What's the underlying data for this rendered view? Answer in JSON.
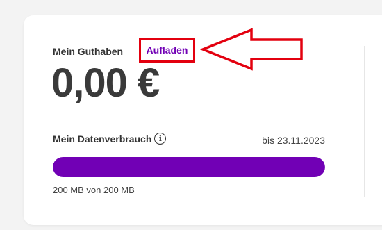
{
  "balance": {
    "label": "Mein Guthaben",
    "topup_label": "Aufladen",
    "value": "0,00 €"
  },
  "data_usage": {
    "label": "Mein Datenverbrauch",
    "info_icon": "info-icon",
    "period": "bis 23.11.2023",
    "progress": 1.0,
    "usage_text": "200 MB von 200 MB"
  },
  "colors": {
    "accent": "#7100b5",
    "annotation": "#e3000f"
  }
}
